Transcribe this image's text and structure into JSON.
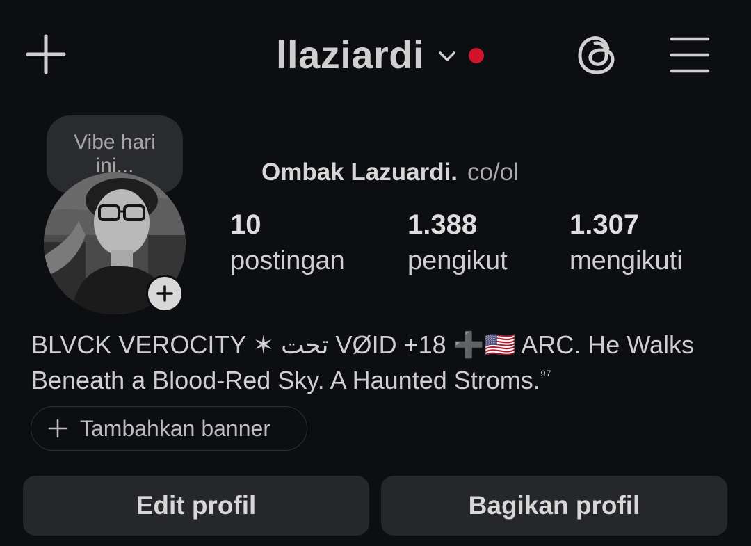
{
  "header": {
    "username": "llaziardi",
    "has_unread_dot": true,
    "accent_dot_color": "#d0122f",
    "icons": [
      "plus-icon",
      "chevron-down-icon",
      "threads-icon",
      "menu-icon"
    ]
  },
  "note": {
    "text": "Vibe hari ini..."
  },
  "profile": {
    "full_name": "Ombak Lazuardi.",
    "pronouns": "co/ol",
    "stats": [
      {
        "value": "10",
        "label": "postingan"
      },
      {
        "value": "1.388",
        "label": "pengikut"
      },
      {
        "value": "1.307",
        "label": "mengikuti"
      }
    ],
    "bio_line1": "BLVCK VEROCITY ✶ تحت VØID +18 ➕🇺🇸 ARC. He Walks",
    "bio_line2": "Beneath a Blood-Red Sky. A Haunted Stroms.",
    "bio_sup": "⁹⁷"
  },
  "actions": {
    "add_banner": "Tambahkan banner",
    "edit_profile": "Edit profil",
    "share_profile": "Bagikan profil"
  }
}
